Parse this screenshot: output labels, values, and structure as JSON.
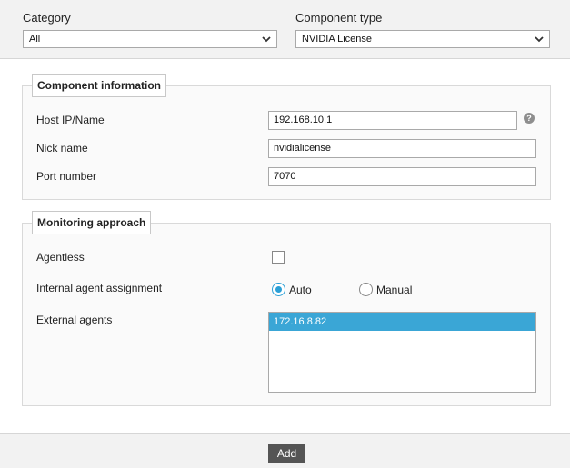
{
  "category": {
    "label": "Category",
    "value": "All"
  },
  "component_type": {
    "label": "Component type",
    "value": "NVIDIA License"
  },
  "component_info": {
    "title": "Component information",
    "host": {
      "label": "Host IP/Name",
      "value": "192.168.10.1"
    },
    "help_icon": "?",
    "nick": {
      "label": "Nick name",
      "value": "nvidialicense"
    },
    "port": {
      "label": "Port number",
      "value": "7070"
    }
  },
  "monitoring": {
    "title": "Monitoring approach",
    "agentless": {
      "label": "Agentless",
      "checked": false
    },
    "assignment": {
      "label": "Internal agent assignment",
      "options": [
        "Auto",
        "Manual"
      ],
      "selected": "Auto"
    },
    "external_agents": {
      "label": "External agents",
      "items": [
        "172.16.8.82"
      ],
      "selected": "172.16.8.82"
    }
  },
  "actions": {
    "add_label": "Add"
  },
  "colors": {
    "accent": "#3aa6d6",
    "button": "#555555"
  },
  "icons": {
    "select_arrow": "chevron-down-icon",
    "help": "help-icon"
  }
}
